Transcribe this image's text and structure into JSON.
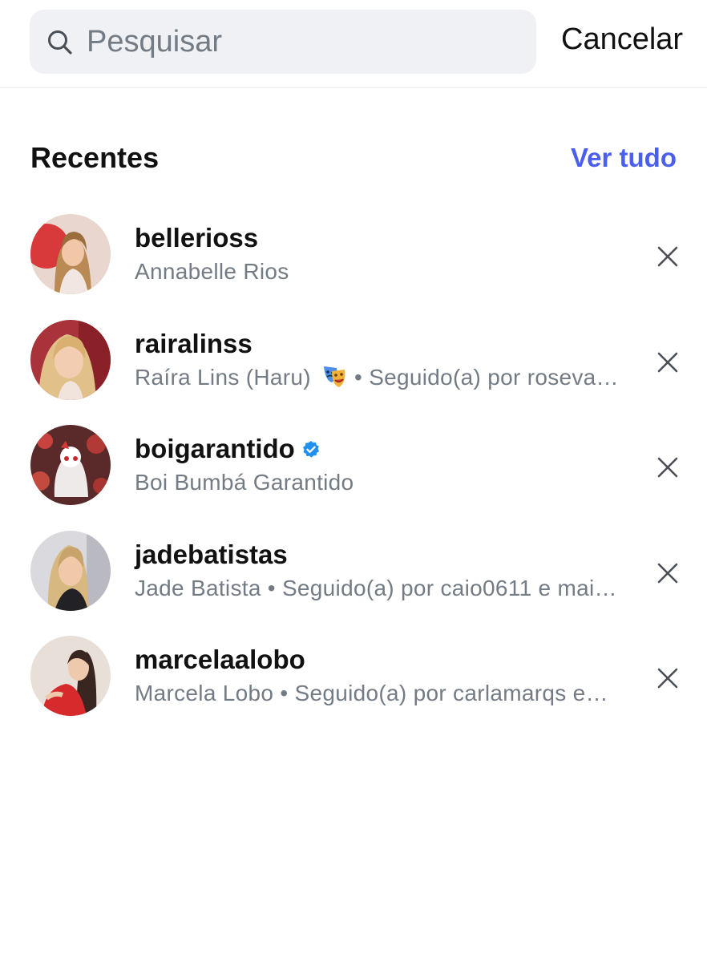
{
  "search": {
    "placeholder": "Pesquisar",
    "value": "",
    "cancel_label": "Cancelar"
  },
  "recents": {
    "title": "Recentes",
    "see_all_label": "Ver tudo",
    "accent_color": "#4a5ff0",
    "items": [
      {
        "username": "bellerioss",
        "subtitle": "Annabelle Rios",
        "verified": false
      },
      {
        "username": "rairalinss",
        "name": "Raíra Lins (Haru)",
        "emoji": "performing-arts-emoji",
        "followed": " • Seguido(a) por rosevas…",
        "verified": false
      },
      {
        "username": "boigarantido",
        "subtitle": "Boi Bumbá Garantido",
        "verified": true,
        "verified_color": "#1f8ff0"
      },
      {
        "username": "jadebatistas",
        "subtitle": "Jade Batista • Seguido(a) por caio0611 e mais…",
        "verified": false
      },
      {
        "username": "marcelaalobo",
        "subtitle": "Marcela Lobo • Seguido(a) por carlamarqs e…",
        "verified": false
      }
    ]
  },
  "icons": {
    "search": "search-icon",
    "remove": "close-icon",
    "verified": "verified-badge-icon"
  },
  "colors": {
    "text_primary": "#111111",
    "text_secondary": "#737b84",
    "search_bg": "#eff1f4"
  }
}
